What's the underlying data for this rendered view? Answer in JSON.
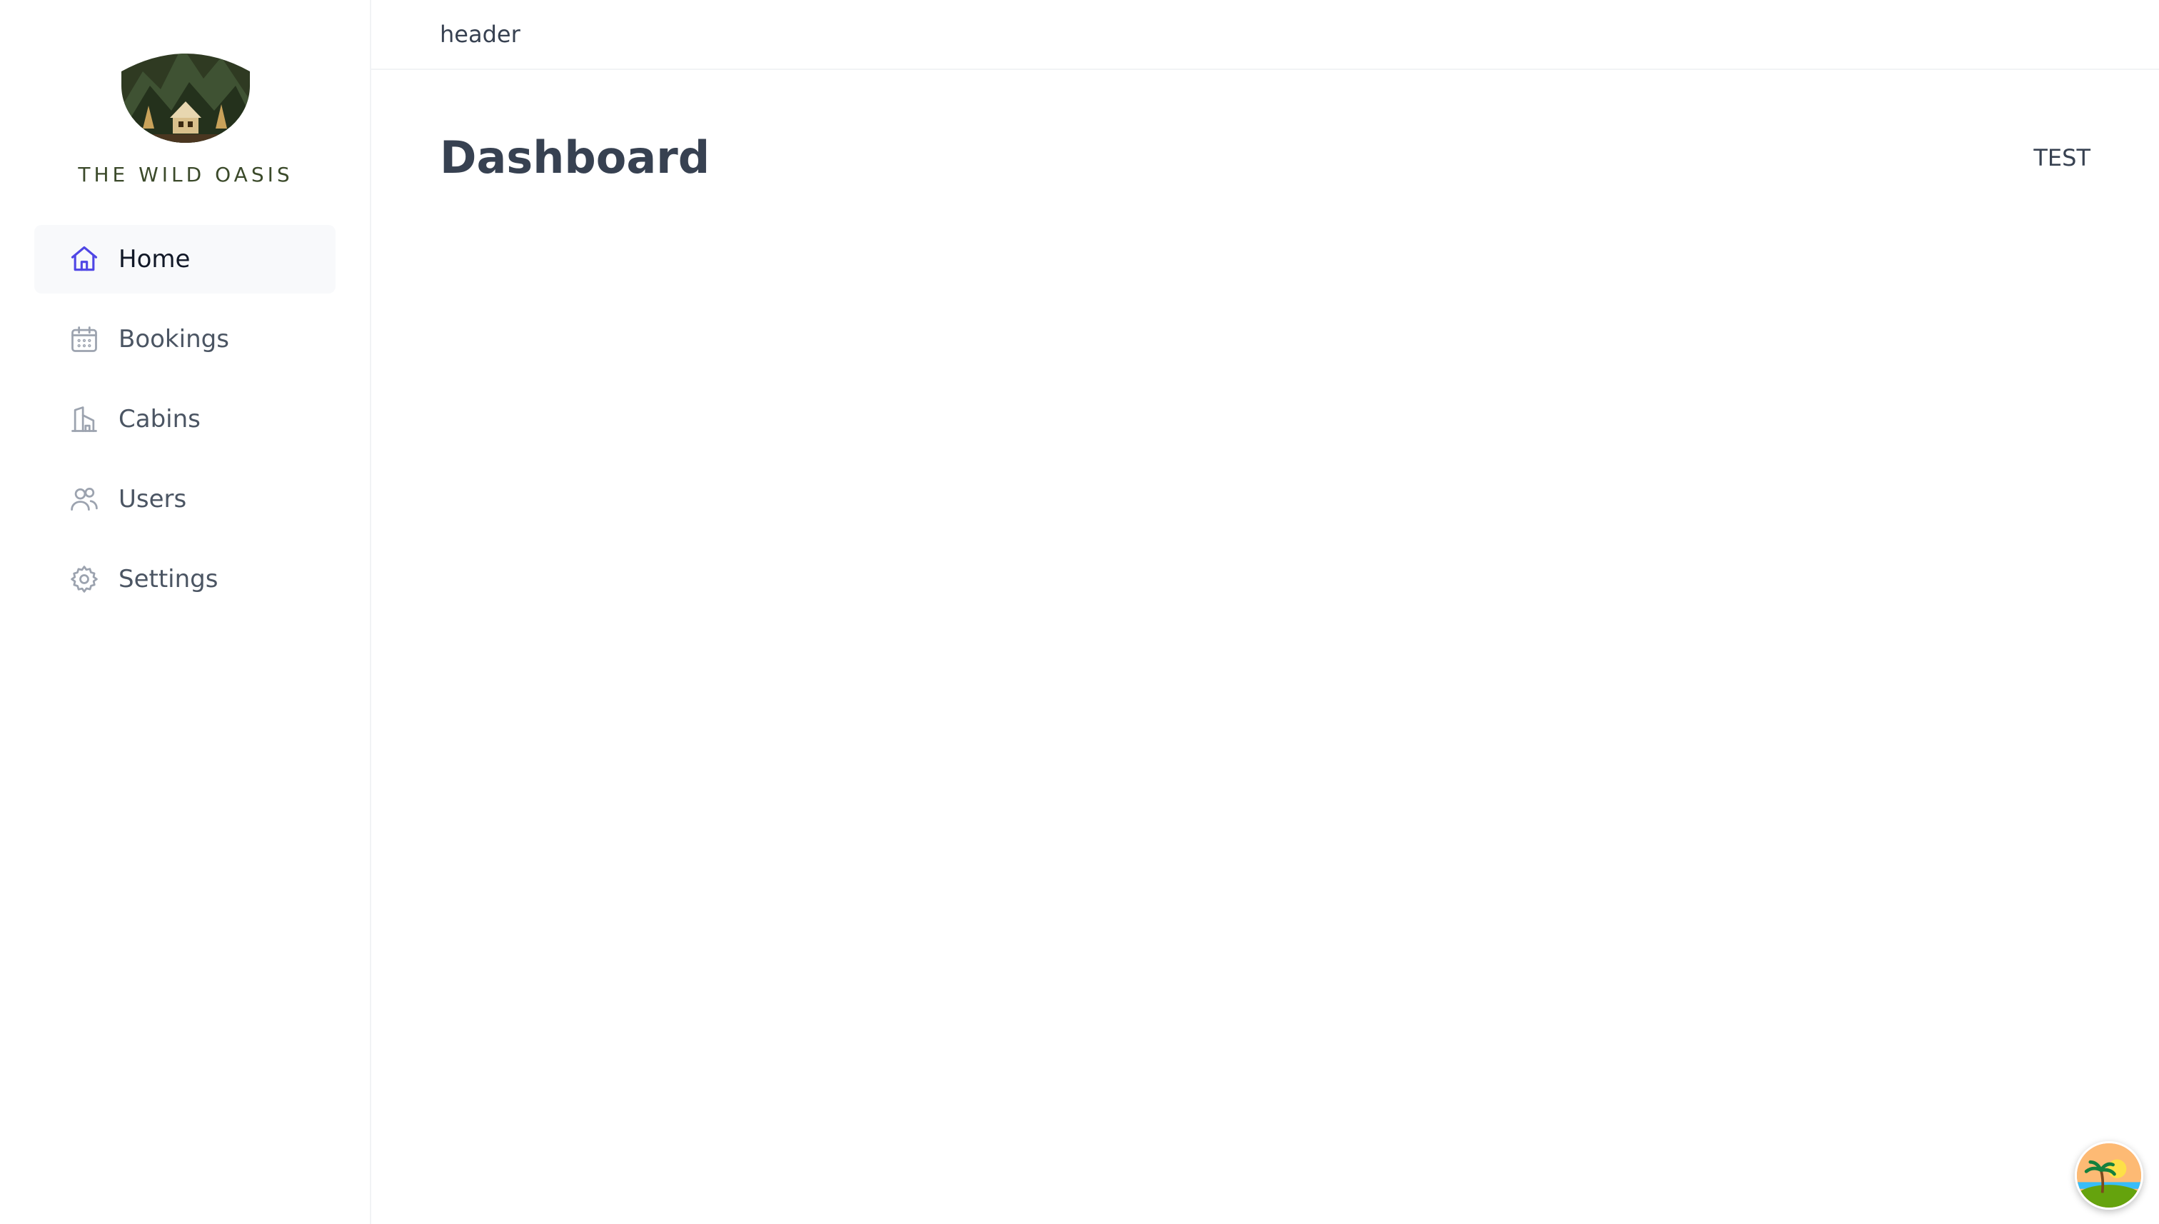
{
  "brand": {
    "name": "THE WILD OASIS",
    "logo_icon": "mountain-cabin-logo"
  },
  "sidebar": {
    "items": [
      {
        "label": "Home",
        "icon": "home-icon",
        "active": true
      },
      {
        "label": "Bookings",
        "icon": "calendar-icon",
        "active": false
      },
      {
        "label": "Cabins",
        "icon": "building-icon",
        "active": false
      },
      {
        "label": "Users",
        "icon": "users-icon",
        "active": false
      },
      {
        "label": "Settings",
        "icon": "gear-icon",
        "active": false
      }
    ]
  },
  "header": {
    "text": "header"
  },
  "main": {
    "title": "Dashboard",
    "right_text": "TEST"
  },
  "fab": {
    "icon": "palm-island-icon"
  },
  "colors": {
    "active_icon": "#4f46e5",
    "icon": "#9ca3af",
    "logo_text": "#3b4a2a"
  }
}
